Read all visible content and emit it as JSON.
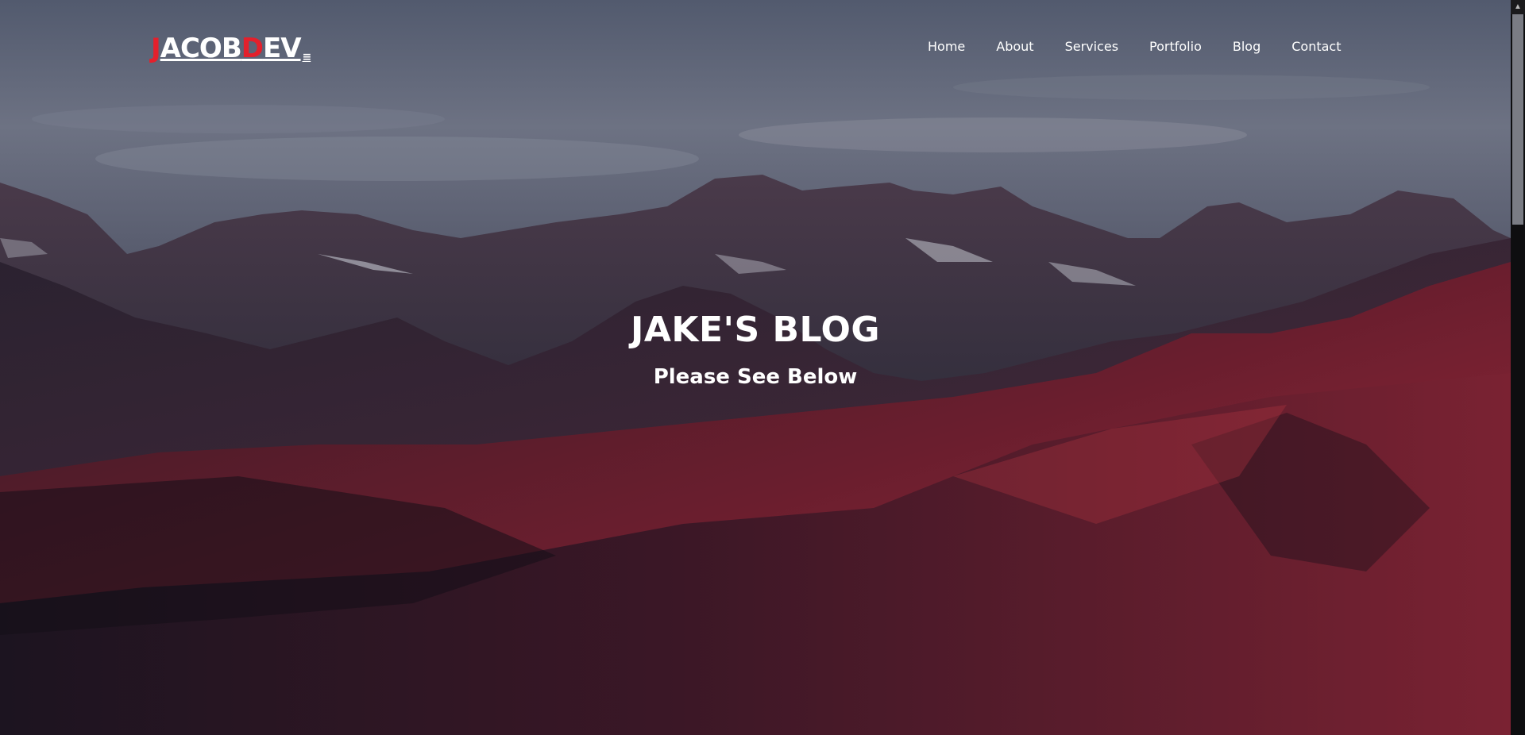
{
  "logo": {
    "part1_red": "J",
    "part2": "ACOB",
    "part3_red": "D",
    "part4": "EV",
    "glyph": "≡"
  },
  "nav": {
    "items": [
      {
        "label": "Home"
      },
      {
        "label": "About"
      },
      {
        "label": "Services"
      },
      {
        "label": "Portfolio"
      },
      {
        "label": "Blog"
      },
      {
        "label": "Contact"
      }
    ]
  },
  "hero": {
    "title": "JAKE'S BLOG",
    "subtitle": "Please See Below"
  },
  "colors": {
    "accent": "#e3202c",
    "text": "#ffffff"
  },
  "scrollbar": {
    "up_glyph": "▲"
  }
}
